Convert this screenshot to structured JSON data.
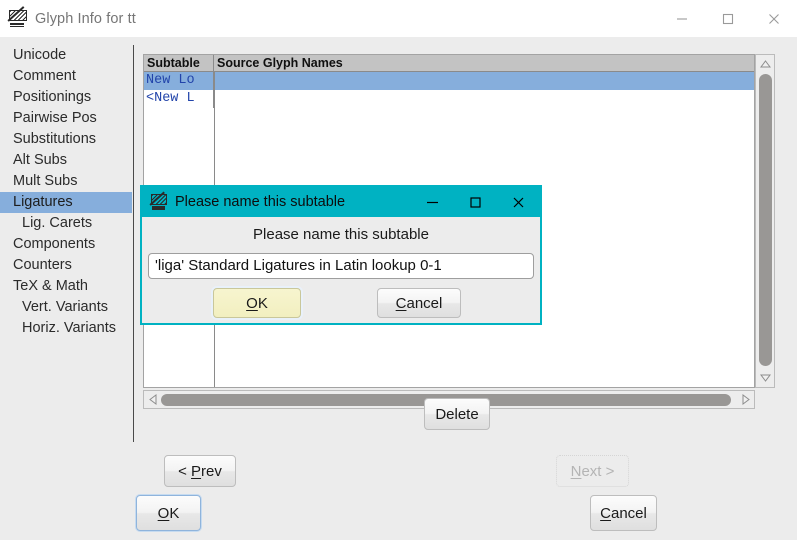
{
  "window": {
    "title": "Glyph Info for tt",
    "icon": "glyph-app-icon",
    "caption": {
      "minimize": "minimize-icon",
      "maximize": "maximize-icon",
      "close": "close-icon"
    }
  },
  "sidebar": {
    "items": [
      {
        "label": "Unicode",
        "selected": false,
        "indent": false
      },
      {
        "label": "Comment",
        "selected": false,
        "indent": false
      },
      {
        "label": "Positionings",
        "selected": false,
        "indent": false
      },
      {
        "label": "Pairwise Pos",
        "selected": false,
        "indent": false
      },
      {
        "label": "Substitutions",
        "selected": false,
        "indent": false
      },
      {
        "label": "Alt Subs",
        "selected": false,
        "indent": false
      },
      {
        "label": "Mult Subs",
        "selected": false,
        "indent": false
      },
      {
        "label": "Ligatures",
        "selected": true,
        "indent": false
      },
      {
        "label": "Lig. Carets",
        "selected": false,
        "indent": true
      },
      {
        "label": "Components",
        "selected": false,
        "indent": false
      },
      {
        "label": "Counters",
        "selected": false,
        "indent": false
      },
      {
        "label": "TeX & Math",
        "selected": false,
        "indent": false
      },
      {
        "label": "Vert. Variants",
        "selected": false,
        "indent": true
      },
      {
        "label": "Horiz. Variants",
        "selected": false,
        "indent": true
      }
    ]
  },
  "list": {
    "columns": [
      "Subtable",
      "Source Glyph Names"
    ],
    "rows": [
      {
        "subtable": "New Lo",
        "source_glyph_names": "",
        "selected": true
      },
      {
        "subtable": "<New L",
        "source_glyph_names": "",
        "selected": false
      }
    ]
  },
  "scrollbars": {
    "vertical": {
      "up_arrow": "scroll-up-arrow-icon",
      "down_arrow": "scroll-down-arrow-icon"
    },
    "horizontal": {
      "left_arrow": "scroll-left-arrow-icon",
      "right_arrow": "scroll-right-arrow-icon"
    }
  },
  "buttons": {
    "delete": "Delete",
    "prev": "< Prev",
    "prev_mnemonic": "P",
    "next": "Next >",
    "next_mnemonic": "N",
    "next_disabled": true,
    "ok": "OK",
    "ok_mnemonic": "O",
    "cancel": "Cancel",
    "cancel_mnemonic": "C"
  },
  "dialog": {
    "title": "Please name this subtable",
    "icon": "glyph-app-icon",
    "prompt": "Please name this subtable",
    "input_value": "'liga' Standard Ligatures in Latin lookup 0-1",
    "ok": "OK",
    "ok_mnemonic": "O",
    "cancel": "Cancel",
    "cancel_mnemonic": "C",
    "caption": {
      "minimize": "minimize-icon",
      "maximize": "maximize-icon",
      "close": "close-icon"
    }
  },
  "colors": {
    "dialog_titlebar": "#00b2c2",
    "selection": "#86aedc",
    "window_background": "#ececec",
    "list_header": "#c3c3c3",
    "default_button": "#f2efc0"
  }
}
